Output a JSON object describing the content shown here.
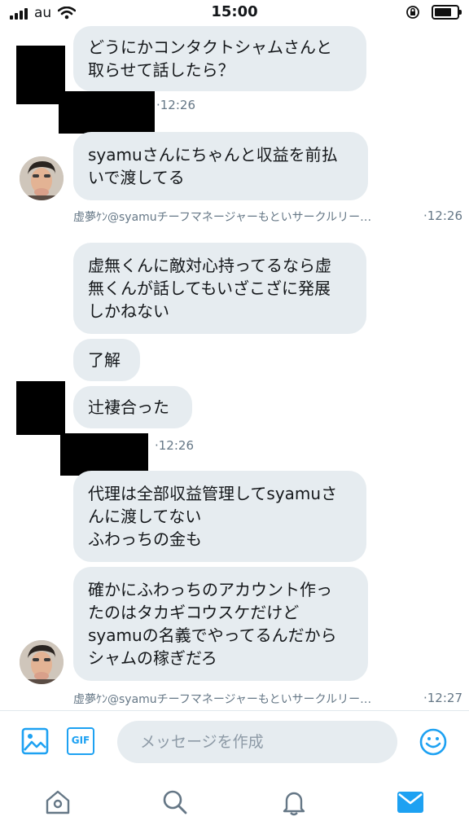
{
  "status_bar": {
    "carrier": "au",
    "time": "15:00"
  },
  "messages": [
    {
      "lines": [
        "どうにかコンタクトシャムさんと",
        "取らせて話したら？"
      ]
    },
    {
      "lines": [
        "syamuさんにちゃんと収益を前払",
        "いで渡してる"
      ]
    },
    {
      "lines": [
        "虚無くんに敵対心持ってるなら虚",
        "無くんが話してもいざこざに発展",
        "しかねない"
      ]
    },
    {
      "lines": [
        "了解"
      ]
    },
    {
      "lines": [
        "辻褄合った"
      ]
    },
    {
      "lines": [
        "代理は全部収益管理してsyamuさ",
        "んに渡してない",
        "ふわっちの金も"
      ]
    },
    {
      "lines": [
        "確かにふわっちのアカウント作っ",
        "たのはタカギコウスケだけど",
        "syamuの名義でやってるんだから",
        "シャムの稼ぎだろ"
      ]
    }
  ],
  "timestamps": [
    "·12:26",
    "·12:26",
    "·12:26",
    "·12:27"
  ],
  "sender_name": "虚夢ｹﾝ@syamuチーフマネージャーもといサークルリー…",
  "composer": {
    "placeholder": "メッセージを作成",
    "gif_label": "GIF"
  },
  "icons": {
    "signal": "signal-icon",
    "wifi": "wifi-icon",
    "orientation_lock": "orientation-lock-icon",
    "battery": "battery-icon",
    "image": "image-icon",
    "gif": "gif-icon",
    "emoji": "emoji-icon",
    "home": "home-icon",
    "search": "search-icon",
    "notifications": "bell-icon",
    "messages": "mail-icon"
  },
  "colors": {
    "accent": "#1da1f2",
    "bubble": "#e6ecf0",
    "muted_text": "#657786",
    "tab_inactive": "#657786"
  }
}
